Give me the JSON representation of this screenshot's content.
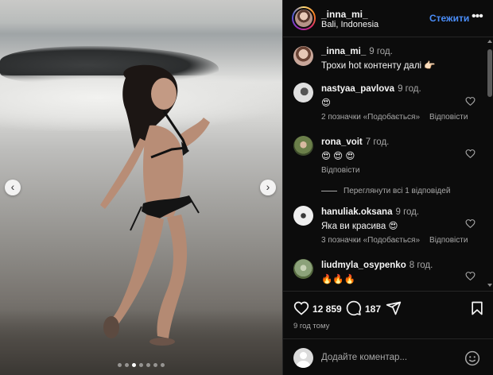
{
  "post": {
    "username": "_inna_mi_",
    "location": "Bali, Indonesia",
    "follow_label": "Стежити",
    "more_label": "•••"
  },
  "carousel": {
    "prev_label": "‹",
    "next_label": "›",
    "dot_count": 7,
    "active_dot": 2
  },
  "comments": [
    {
      "username": "_inna_mi_",
      "time": "9 год.",
      "text": "Трохи hot контенту далі 👉🏻",
      "likes": "",
      "reply": "",
      "is_caption": true,
      "avatar_color": "#c9a79a"
    },
    {
      "username": "nastyaa_pavlova",
      "time": "9 год.",
      "text": "😍",
      "likes": "2 позначки «Подобається»",
      "reply": "Відповісти",
      "avatar_color": "#cfcfcf"
    },
    {
      "username": "rona_voit",
      "time": "7 год.",
      "text": "😍 😍 😍",
      "likes": "",
      "reply": "Відповісти",
      "avatar_color": "#6b7f4a"
    },
    {
      "username": "hanuliak.oksana",
      "time": "9 год.",
      "text": "Яка ви красива 😍",
      "likes": "3 позначки «Подобається»",
      "reply": "Відповісти",
      "avatar_color": "#e8e4e0"
    },
    {
      "username": "liudmyla_osypenko",
      "time": "8 год.",
      "text": "🔥🔥🔥",
      "likes": "",
      "reply": "",
      "avatar_color": "#8ca27a"
    }
  ],
  "replies_link": "Переглянути всі 1 відповідей",
  "actions": {
    "like_count": "12 859",
    "comment_count": "187",
    "time_ago": "9 год тому"
  },
  "add_comment": {
    "placeholder": "Додайте коментар..."
  },
  "icons": {
    "like": "heart-icon",
    "comment": "comment-icon",
    "share": "share-icon",
    "save": "bookmark-icon",
    "emoji": "emoji-icon",
    "more": "more-dots-icon"
  }
}
